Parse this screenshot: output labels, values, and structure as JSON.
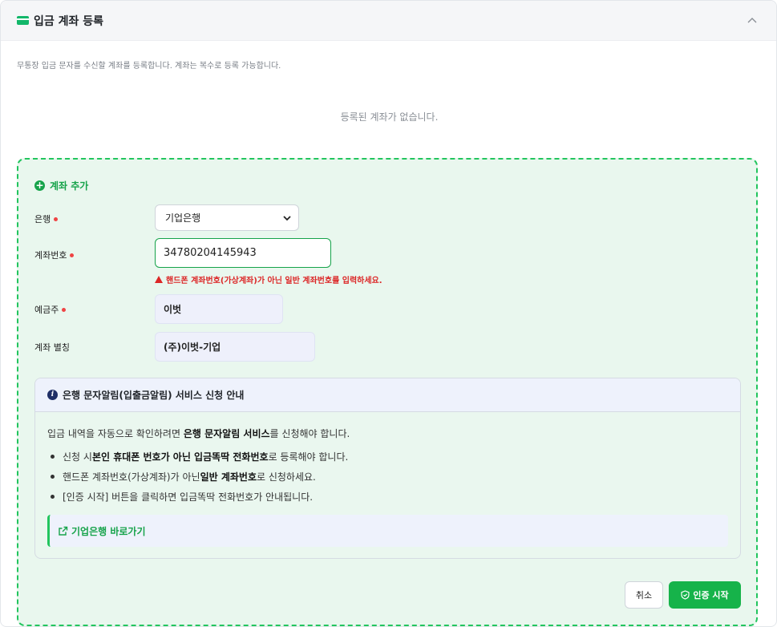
{
  "header": {
    "title": "입금 계좌 등록"
  },
  "description": "무통장 입금 문자를 수신할 계좌를 등록합니다. 계좌는 복수로 등록 가능합니다.",
  "empty_message": "등록된 계좌가 없습니다.",
  "add_form": {
    "title": "계좌 추가",
    "bank_label": "은행",
    "bank_selected": "기업은행",
    "account_label": "계좌번호",
    "account_value": "34780204145943",
    "account_warning": "핸드폰 계좌번호(가상계좌)가 아닌 일반 계좌번호를 입력하세요.",
    "holder_label": "예금주",
    "holder_value": "이벗",
    "alias_label": "계좌 별칭",
    "alias_value": "(주)이벗-기업"
  },
  "info": {
    "title": "은행 문자알림(입출금알림) 서비스 신청 안내",
    "intro_prefix": "입금 내역을 자동으로 확인하려면 ",
    "intro_bold": "은행 문자알림 서비스",
    "intro_suffix": "를 신청해야 합니다.",
    "bullet1_prefix": "신청 시 ",
    "bullet1_bold": "본인 휴대폰 번호가 아닌 입금똑딱 전화번호",
    "bullet1_suffix": "로 등록해야 합니다.",
    "bullet2_prefix": "핸드폰 계좌번호(가상계좌)가 아닌 ",
    "bullet2_bold": "일반 계좌번호",
    "bullet2_suffix": "로 신청하세요.",
    "bullet3": "[인증 시작] 버튼을 클릭하면 입금똑딱 전화번호가 안내됩니다.",
    "link_label": "기업은행 바로가기"
  },
  "buttons": {
    "cancel": "취소",
    "start": "인증 시작"
  },
  "colors": {
    "accent": "#16a34a",
    "required": "#ef4444",
    "warning": "#dc2626"
  }
}
